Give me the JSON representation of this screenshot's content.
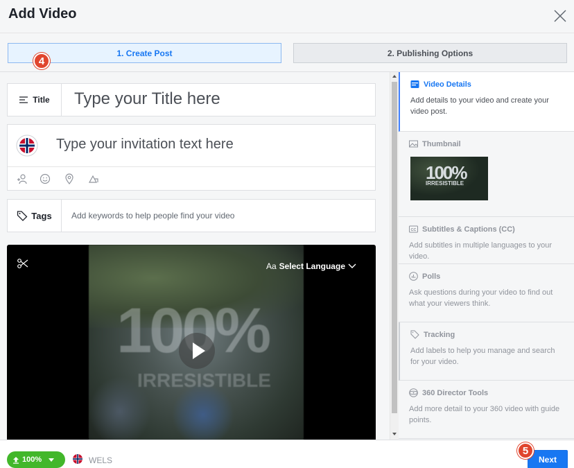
{
  "dialog": {
    "title": "Add Video"
  },
  "steps": [
    {
      "label": "1. Create Post",
      "active": true
    },
    {
      "label": "2. Publishing Options",
      "active": false
    }
  ],
  "badges": {
    "step_badge": "4",
    "next_badge": "5"
  },
  "title_field": {
    "label": "Title",
    "placeholder": "Type your Title here"
  },
  "invitation_field": {
    "placeholder": "Type your invitation text here"
  },
  "post_tools": [
    "tag-people-icon",
    "emoji-icon",
    "location-icon",
    "check-in-icon"
  ],
  "tags_field": {
    "label": "Tags",
    "placeholder": "Add keywords to help people find your video"
  },
  "video": {
    "language_prefix": "Aa",
    "language_label": "Select Language",
    "overlay_text": "100%",
    "overlay_sub": "IRRESISTIBLE"
  },
  "sidebar": {
    "sections": [
      {
        "title": "Video Details",
        "description": "Add details to your video and create your video post.",
        "active": true,
        "icon": "video-details-icon"
      },
      {
        "title": "Thumbnail",
        "description": "",
        "icon": "image-icon"
      },
      {
        "title": "Subtitles & Captions (CC)",
        "description": "Add subtitles in multiple languages to your video.",
        "icon": "cc-icon"
      },
      {
        "title": "Polls",
        "description": "Ask questions during your video to find out what your viewers think.",
        "icon": "poll-icon"
      },
      {
        "title": "Tracking",
        "description": "Add labels to help you manage and search for your video.",
        "icon": "tag-icon"
      },
      {
        "title": "360 Director Tools",
        "description": "Add more detail to your 360 video with guide points.",
        "icon": "360-icon"
      }
    ],
    "thumbnail_text": "100%",
    "thumbnail_sub": "IRRESISTIBLE"
  },
  "footer": {
    "upload_progress": "100%",
    "page_name": "WELS",
    "next_label": "Next"
  },
  "colors": {
    "primary": "#1877f2",
    "upload_green": "#42b72a",
    "badge_red": "#e0452e"
  }
}
